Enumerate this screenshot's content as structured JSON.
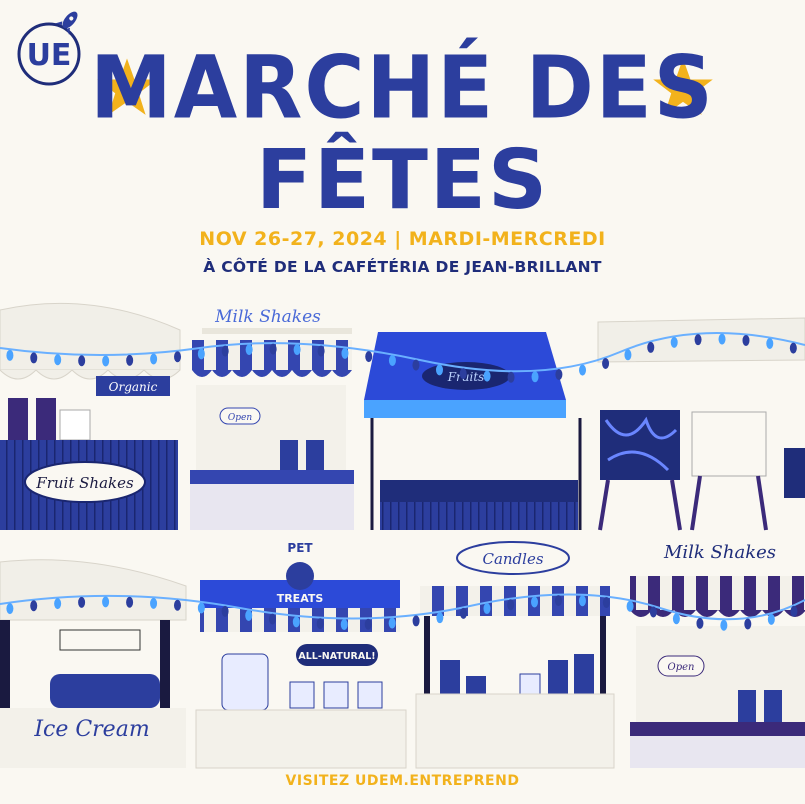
{
  "logo": {
    "text": "UE",
    "icon": "rocket-icon"
  },
  "title": {
    "line1": "MARCHÉ DES",
    "line2": "FÊTES"
  },
  "event": {
    "date": "NOV 26-27, 2024 | MARDI-MERCREDI",
    "location": "À CÔTÉ DE LA CAFÉTÉRIA DE JEAN-BRILLANT"
  },
  "stalls": {
    "milkshakes_top": "Milk Shakes",
    "organic": "Organic",
    "fruit_shakes": "Fruit Shakes",
    "fruits": "Fruits",
    "open_top": "Open",
    "pet_treats_1": "PET",
    "pet_treats_2": "TREATS",
    "all_natural": "ALL-NATURAL!",
    "candles": "Candles",
    "milkshakes_bottom": "Milk Shakes",
    "open_bottom": "Open",
    "ice_cream": "Ice Cream"
  },
  "footer": {
    "cta": "VISITEZ UDEM.ENTREPREND"
  },
  "colors": {
    "primary": "#2c3e9e",
    "accent": "#f2b21c",
    "dark_blue": "#1f2d7a",
    "purple": "#3b2a7a",
    "light_blue": "#4aa3ff",
    "background": "#faf8f2"
  }
}
